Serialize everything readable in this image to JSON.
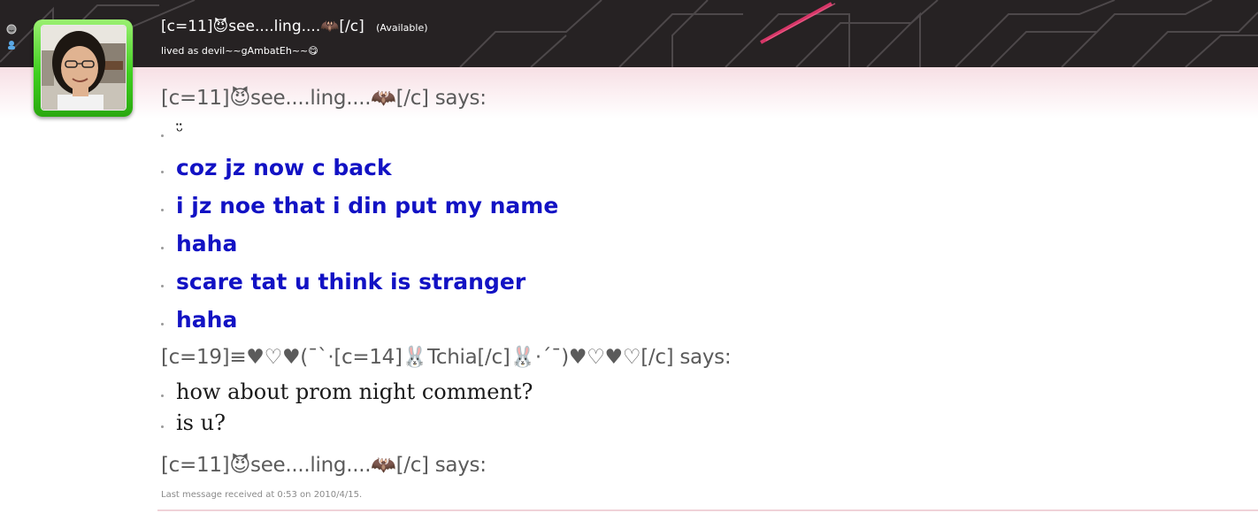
{
  "header": {
    "contact_name": "[c=11]😈see....ling....🦇[/c]",
    "status": "(Available)",
    "personal_message": "lived as devil~~gAmbatEh~~😋"
  },
  "conversation": {
    "blocks": [
      {
        "sender": "[c=11]😈see....ling....🦇[/c] says:",
        "messages": [
          "ᵕ̈",
          "coz jz now c back",
          "i jz noe that i din put my name",
          "haha",
          "scare tat u think is stranger",
          "haha"
        ]
      },
      {
        "sender": "[c=19]≡♥♡♥(¯`·[c=14]🐰Tchia[/c]🐰·´¯)♥♡♥♡[/c] says:",
        "messages": [
          "how about prom night comment?",
          "is u?"
        ]
      },
      {
        "sender": "[c=11]😈see....ling....🦇[/c] says:",
        "messages": []
      }
    ]
  },
  "footer": {
    "last_received": "Last message received at 0:53 on 2010/4/15."
  },
  "colors": {
    "header_bg": "#262223",
    "accent_pink": "#e8396f",
    "message_blue": "#1212c4",
    "avatar_green": "#3fcf1f"
  }
}
